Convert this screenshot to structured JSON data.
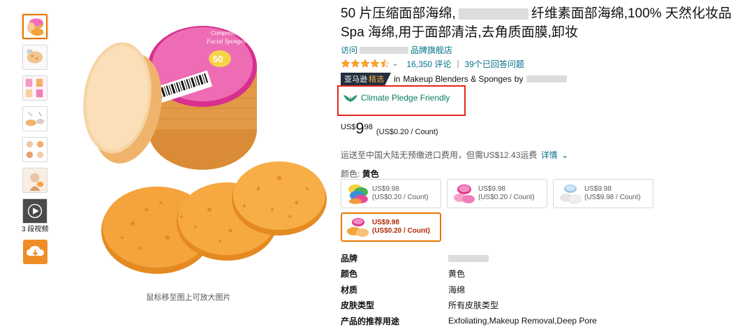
{
  "gallery": {
    "video_label": "3 段视频",
    "zoom_hint": "鼠标移至图上可放大图片",
    "package_text": {
      "line1": "Compressed",
      "line2": "Facial Sponges",
      "count": "50"
    }
  },
  "product": {
    "title_part1": "50 片压缩面部海绵,",
    "title_part2": "纤维素面部海绵,100% 天然化妆品 Spa 海绵,用于面部清洁,去角质面膜,卸妆",
    "store_prefix": "访问",
    "store_suffix": "品牌旗舰店",
    "rating_caret": "⌄",
    "reviews": "16,350 评论",
    "separator": "|",
    "answered": "39个已回答问题",
    "badge_brand": "亚马逊",
    "badge_choice": "精选",
    "badge_in": "in",
    "category": "Makeup Blenders & Sponges",
    "by": "by",
    "climate_label": "Climate Pledge Friendly",
    "price": {
      "currency": "US$",
      "whole": "9",
      "fraction": "98",
      "unit_price": "(US$0.20 / Count)"
    },
    "shipping": {
      "text": "运送至中国大陆无预缴进口费用，但需US$12.43运费",
      "details": "详情",
      "caret": "⌄"
    },
    "color": {
      "label": "颜色:",
      "value": "黄色"
    },
    "variants": [
      {
        "price": "US$9.98",
        "unit": "(US$0.20 / Count)"
      },
      {
        "price": "US$9.98",
        "unit": "(US$0.20 / Count)"
      },
      {
        "price": "US$9.98",
        "unit": "(US$9.98 / Count)"
      },
      {
        "price": "US$9.98",
        "unit": "(US$0.20 / Count)"
      }
    ],
    "specs": [
      {
        "key": "品牌",
        "value": ""
      },
      {
        "key": "颜色",
        "value": "黄色"
      },
      {
        "key": "材质",
        "value": "海绵"
      },
      {
        "key": "皮肤类型",
        "value": "所有皮肤类型"
      },
      {
        "key": "产品的推荐用途",
        "value": "Exfoliating,Makeup Removal,Deep Pore"
      }
    ]
  },
  "colors": {
    "link": "#007185",
    "price_red": "#b12704",
    "climate_green": "#067d62",
    "highlight_red": "#e3261b",
    "selected_orange": "#e77600",
    "star": "#ffa41c",
    "badge_dark": "#232f3e",
    "download_orange": "#f08c28"
  },
  "icons": {
    "climate": "leaf-wings-icon",
    "download": "cloud-download-icon",
    "play": "play-icon",
    "stars": "star-icon"
  }
}
